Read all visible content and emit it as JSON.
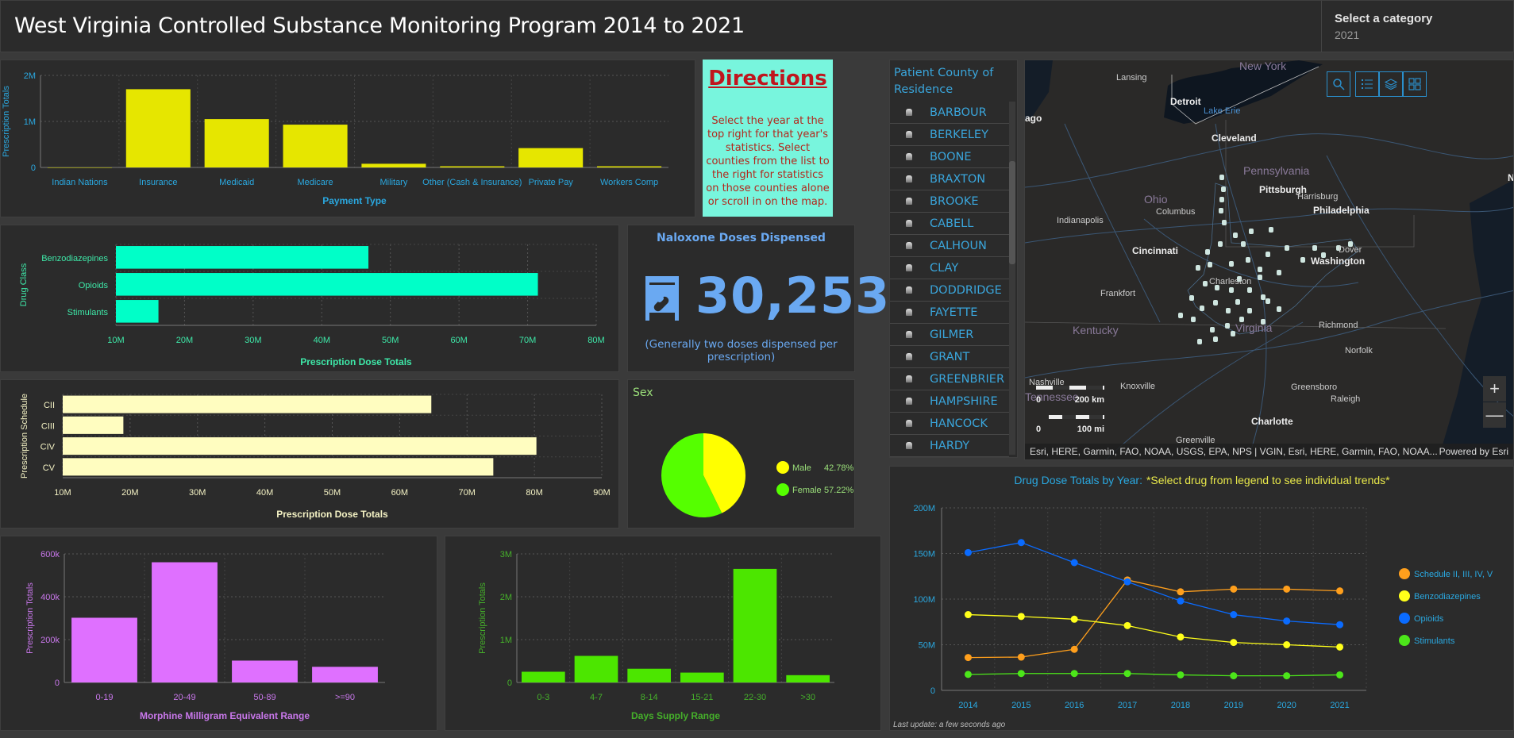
{
  "header": {
    "title": "West Virginia Controlled Substance Monitoring Program 2014 to 2021",
    "category_label": "Select a category",
    "category_value": "2021"
  },
  "directions": {
    "title": "Directions",
    "text": "Select the year at the top right for that year's statistics. Select counties from the list to the right for statistics on those counties alone or scroll in on the map."
  },
  "county_list": {
    "title": "Patient County of Residence",
    "items": [
      "BARBOUR",
      "BERKELEY",
      "BOONE",
      "BRAXTON",
      "BROOKE",
      "CABELL",
      "CALHOUN",
      "CLAY",
      "DODDRIDGE",
      "FAYETTE",
      "GILMER",
      "GRANT",
      "GREENBRIER",
      "HAMPSHIRE",
      "HANCOCK",
      "HARDY"
    ]
  },
  "map": {
    "labels": [
      {
        "text": "Lansing",
        "kind": "city"
      },
      {
        "text": "Detroit",
        "kind": "major"
      },
      {
        "text": "Lake Erie",
        "kind": "water"
      },
      {
        "text": "ago",
        "kind": "major"
      },
      {
        "text": "Cleveland",
        "kind": "major"
      },
      {
        "text": "Pennsylvania",
        "kind": "state"
      },
      {
        "text": "Pittsburgh",
        "kind": "major"
      },
      {
        "text": "Harrisburg",
        "kind": "city"
      },
      {
        "text": "Ohio",
        "kind": "state"
      },
      {
        "text": "Columbus",
        "kind": "city"
      },
      {
        "text": "Indianapolis",
        "kind": "city"
      },
      {
        "text": "Philadelphia",
        "kind": "major"
      },
      {
        "text": "Cincinnati",
        "kind": "major"
      },
      {
        "text": "Dover",
        "kind": "city"
      },
      {
        "text": "Washington",
        "kind": "major"
      },
      {
        "text": "Frankfort",
        "kind": "city"
      },
      {
        "text": "Charleston",
        "kind": "city"
      },
      {
        "text": "Kentucky",
        "kind": "state"
      },
      {
        "text": "Virginia",
        "kind": "state"
      },
      {
        "text": "Richmond",
        "kind": "city"
      },
      {
        "text": "Norfolk",
        "kind": "city"
      },
      {
        "text": "Nashville",
        "kind": "city"
      },
      {
        "text": "Knoxville",
        "kind": "city"
      },
      {
        "text": "Greensboro",
        "kind": "city"
      },
      {
        "text": "Raleigh",
        "kind": "city"
      },
      {
        "text": "Charlotte",
        "kind": "major"
      },
      {
        "text": "Greenville",
        "kind": "city"
      },
      {
        "text": "Tennessee",
        "kind": "state"
      },
      {
        "text": "New York",
        "kind": "state"
      },
      {
        "text": "Ne",
        "kind": "major"
      }
    ],
    "scale_km": "200 km",
    "scale_mi": "100 mi",
    "scale_zero": "0",
    "attribution": "Esri, HERE, Garmin, FAO, NOAA, USGS, EPA, NPS | VGIN, Esri, HERE, Garmin, FAO, NOAA...",
    "powered_by": "Powered by Esri",
    "zoom_in": "+",
    "zoom_out": "—",
    "tools": [
      "search-icon",
      "legend-icon",
      "layers-icon",
      "basemap-gallery-icon"
    ]
  },
  "naloxone": {
    "title": "Naloxone Doses Dispensed",
    "value": "30,253",
    "footnote": "(Generally two doses dispensed per prescription)",
    "icon": "pill-bottle-icon"
  },
  "chart_data": [
    {
      "id": "payment",
      "type": "bar",
      "title": "",
      "xlabel": "Payment Type",
      "ylabel": "Prescription Totals",
      "categories": [
        "Indian Nations",
        "Insurance",
        "Medicaid",
        "Medicare",
        "Military",
        "Other (Cash & Insurance)",
        "Private Pay",
        "Workers Comp"
      ],
      "values": [
        0,
        1700000,
        1050000,
        930000,
        80000,
        25000,
        420000,
        25000
      ],
      "yticks": [
        "0",
        "1M",
        "2M"
      ],
      "ylim": [
        0,
        2000000
      ],
      "color": "#e6e600",
      "label_color": "#2aa8e0",
      "grid": true
    },
    {
      "id": "drug_class",
      "type": "bar",
      "orientation": "horizontal",
      "xlabel": "Prescription Dose Totals",
      "ylabel": "Drug Class",
      "categories": [
        "Benzodiazepines",
        "Opioids",
        "Stimulants"
      ],
      "values": [
        46800000,
        71500000,
        16200000
      ],
      "xticks": [
        "10M",
        "20M",
        "30M",
        "40M",
        "50M",
        "60M",
        "70M",
        "80M"
      ],
      "xlim": [
        10000000,
        80000000
      ],
      "color": "#00ffc8",
      "label_color": "#3ee8a8",
      "grid": true
    },
    {
      "id": "schedule",
      "type": "bar",
      "orientation": "horizontal",
      "xlabel": "Prescription Dose Totals",
      "ylabel": "Prescription Schedule",
      "categories": [
        "CII",
        "CIII",
        "CIV",
        "CV"
      ],
      "values": [
        64700000,
        19000000,
        80300000,
        73900000
      ],
      "xticks": [
        "10M",
        "20M",
        "30M",
        "40M",
        "50M",
        "60M",
        "70M",
        "80M",
        "90M"
      ],
      "xlim": [
        10000000,
        90000000
      ],
      "color": "#fffdc0",
      "label_color": "#f4f2c4",
      "grid": true
    },
    {
      "id": "sex",
      "type": "pie",
      "title": "Sex",
      "slices": [
        {
          "label": "Male",
          "value": 42.78,
          "display": "42.78%",
          "color": "#ffff00"
        },
        {
          "label": "Female",
          "value": 57.22,
          "display": "57.22%",
          "color": "#55ff00"
        }
      ],
      "legend": "right"
    },
    {
      "id": "mme",
      "type": "bar",
      "xlabel": "Morphine Milligram Equivalent Range",
      "ylabel": "Prescription Totals",
      "categories": [
        "0-19",
        "20-49",
        "50-89",
        ">=90"
      ],
      "values": [
        302000,
        561000,
        102000,
        73000
      ],
      "yticks": [
        "0",
        "200k",
        "400k",
        "600k"
      ],
      "ylim": [
        0,
        600000
      ],
      "color": "#df70ff",
      "label_color": "#c877ea",
      "grid": true
    },
    {
      "id": "days_supply",
      "type": "bar",
      "xlabel": "Days Supply Range",
      "ylabel": "Prescription Totals",
      "categories": [
        "0-3",
        "4-7",
        "8-14",
        "15-21",
        "22-30",
        ">30"
      ],
      "values": [
        250000,
        620000,
        320000,
        230000,
        2650000,
        170000
      ],
      "yticks": [
        "0",
        "1M",
        "2M",
        "3M"
      ],
      "ylim": [
        0,
        3000000
      ],
      "color": "#4ce600",
      "label_color": "#45b02a",
      "grid": true
    },
    {
      "id": "dose_by_year",
      "type": "line",
      "title": "Drug Dose Totals by Year:",
      "subtitle": "*Select drug from legend to see individual trends*",
      "x": [
        "2014",
        "2015",
        "2016",
        "2017",
        "2018",
        "2019",
        "2020",
        "2021"
      ],
      "yticks": [
        "0",
        "50M",
        "100M",
        "150M",
        "200M"
      ],
      "ylim": [
        0,
        200000000
      ],
      "legend": "right",
      "series": [
        {
          "name": "Schedule II, III, IV, V",
          "color": "#ff9f1c",
          "values": [
            36000000,
            36500000,
            45000000,
            121000000,
            108000000,
            111000000,
            111000000,
            109000000
          ]
        },
        {
          "name": "Benzodiazepines",
          "color": "#ffff1a",
          "values": [
            83000000,
            81000000,
            78000000,
            71000000,
            58500000,
            52500000,
            50000000,
            47500000
          ]
        },
        {
          "name": "Opioids",
          "color": "#0a6bff",
          "values": [
            151000000,
            162000000,
            140000000,
            119000000,
            98000000,
            83000000,
            76000000,
            72000000
          ]
        },
        {
          "name": "Stimulants",
          "color": "#4ce61a",
          "values": [
            17500000,
            18500000,
            18500000,
            18500000,
            17000000,
            16000000,
            16000000,
            17000000
          ]
        }
      ],
      "footnote": "Last update: a few seconds ago",
      "label_color": "#2aa8e0"
    }
  ]
}
